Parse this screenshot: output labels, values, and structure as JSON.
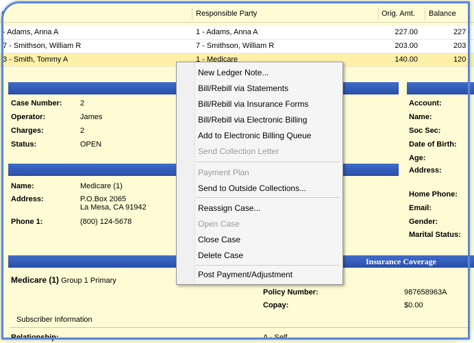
{
  "grid": {
    "columns": [
      "t",
      "Responsible Party",
      "Orig. Amt.",
      "Balance"
    ],
    "rows": [
      {
        "patient": "- Adams, Anna A",
        "party": "1 - Adams, Anna A",
        "orig": "227.00",
        "balance": "227"
      },
      {
        "patient": "7 - Smithson, William R",
        "party": "7 - Smithson, William R",
        "orig": "203.00",
        "balance": "203"
      },
      {
        "patient": "3 - Smith, Tommy A",
        "party": "1 - Medicare",
        "orig": "140.00",
        "balance": "120"
      }
    ]
  },
  "case": {
    "labels": {
      "case_number": "Case Number:",
      "operator": "Operator:",
      "charges": "Charges:",
      "status": "Status:"
    },
    "values": {
      "case_number": "2",
      "operator": "James",
      "charges": "2",
      "status": "OPEN"
    }
  },
  "insurer": {
    "labels": {
      "name": "Name:",
      "address": "Address:",
      "phone": "Phone 1:"
    },
    "values": {
      "name": "Medicare (1)",
      "address_line1": "P.O.Box 2065",
      "address_line2": "La Mesa, CA 91942",
      "phone": "(800) 124-5678"
    }
  },
  "patient": {
    "labels": {
      "account": "Account:",
      "name": "Name:",
      "soc_sec": "Soc Sec:",
      "dob": "Date of Birth:",
      "age": "Age:",
      "address": "Address:",
      "home_phone": "Home Phone:",
      "email": "Email:",
      "gender": "Gender:",
      "marital": "Marital Status:"
    }
  },
  "coverage": {
    "title": "Insurance Coverage",
    "plan_bold": "Medicare (1)",
    "plan_rest": "Group 1 Primary",
    "policy_label": "Policy Number:",
    "policy_value": "987658963A",
    "copay_label": "Copay:",
    "copay_value": "$0.00",
    "subscriber_header": "Subscriber Information",
    "relationship_label": "Relationship:",
    "relationship_value": "A - Self"
  },
  "context_menu": {
    "items": [
      {
        "label": "New Ledger Note...",
        "enabled": true
      },
      {
        "label": "Bill/Rebill via Statements",
        "enabled": true
      },
      {
        "label": "Bill/Rebill via Insurance Forms",
        "enabled": true
      },
      {
        "label": "Bill/Rebill via Electronic Billing",
        "enabled": true
      },
      {
        "label": "Add to Electronic Billing Queue",
        "enabled": true
      },
      {
        "label": "Send Collection Letter",
        "enabled": false
      },
      {
        "label": "Payment Plan",
        "enabled": false
      },
      {
        "label": "Send to Outside Collections...",
        "enabled": true
      },
      {
        "label": "Reassign Case...",
        "enabled": true
      },
      {
        "label": "Open Case",
        "enabled": false
      },
      {
        "label": "Close Case",
        "enabled": true
      },
      {
        "label": "Delete Case",
        "enabled": true
      },
      {
        "label": "Post Payment/Adjustment",
        "enabled": true
      }
    ]
  },
  "colors": {
    "section_bar": "#2f58b4",
    "selected_row": "#fff0a8",
    "panel_bg": "#fffbd5",
    "frame_border": "#5b86d6"
  }
}
